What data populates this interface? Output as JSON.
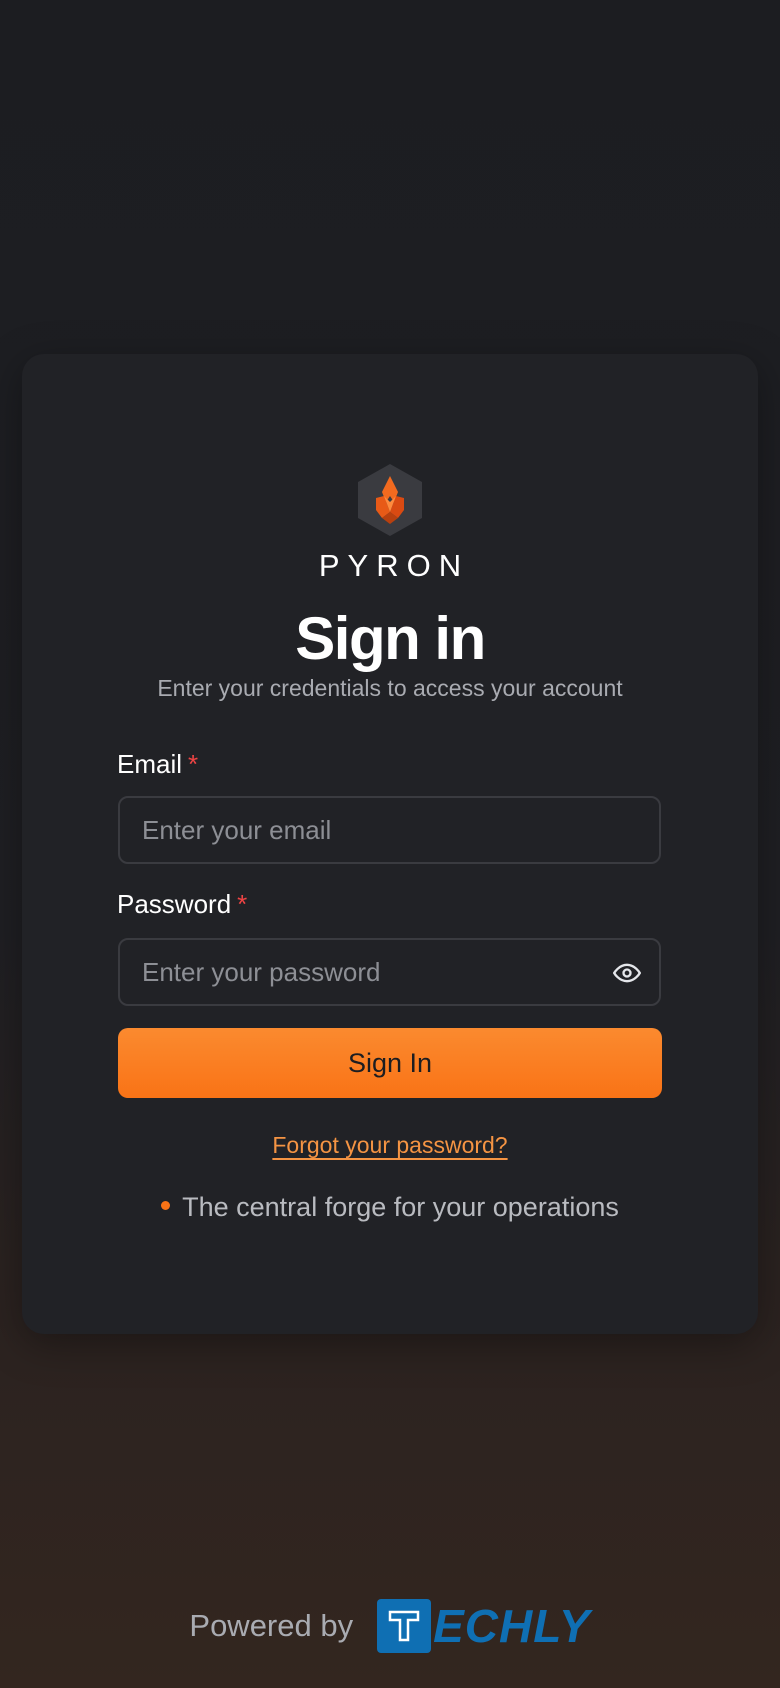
{
  "brand": {
    "name": "PYRON",
    "logo_icon": "flame-crystal-hexagon-icon",
    "accent": "#f97316"
  },
  "signin": {
    "title": "Sign in",
    "subtitle": "Enter your credentials to access your account",
    "email_label": "Email",
    "email_required": "*",
    "email_placeholder": "Enter your email",
    "email_value": "",
    "password_label": "Password",
    "password_required": "*",
    "password_placeholder": "Enter your password",
    "password_value": "",
    "password_toggle_icon": "eye-icon",
    "submit_label": "Sign In",
    "forgot_label": "Forgot your password?",
    "tagline": "The central forge for your operations"
  },
  "footer": {
    "powered_by": "Powered by",
    "partner_logo": "TECHLY",
    "partner_color": "#0f6fb3"
  }
}
